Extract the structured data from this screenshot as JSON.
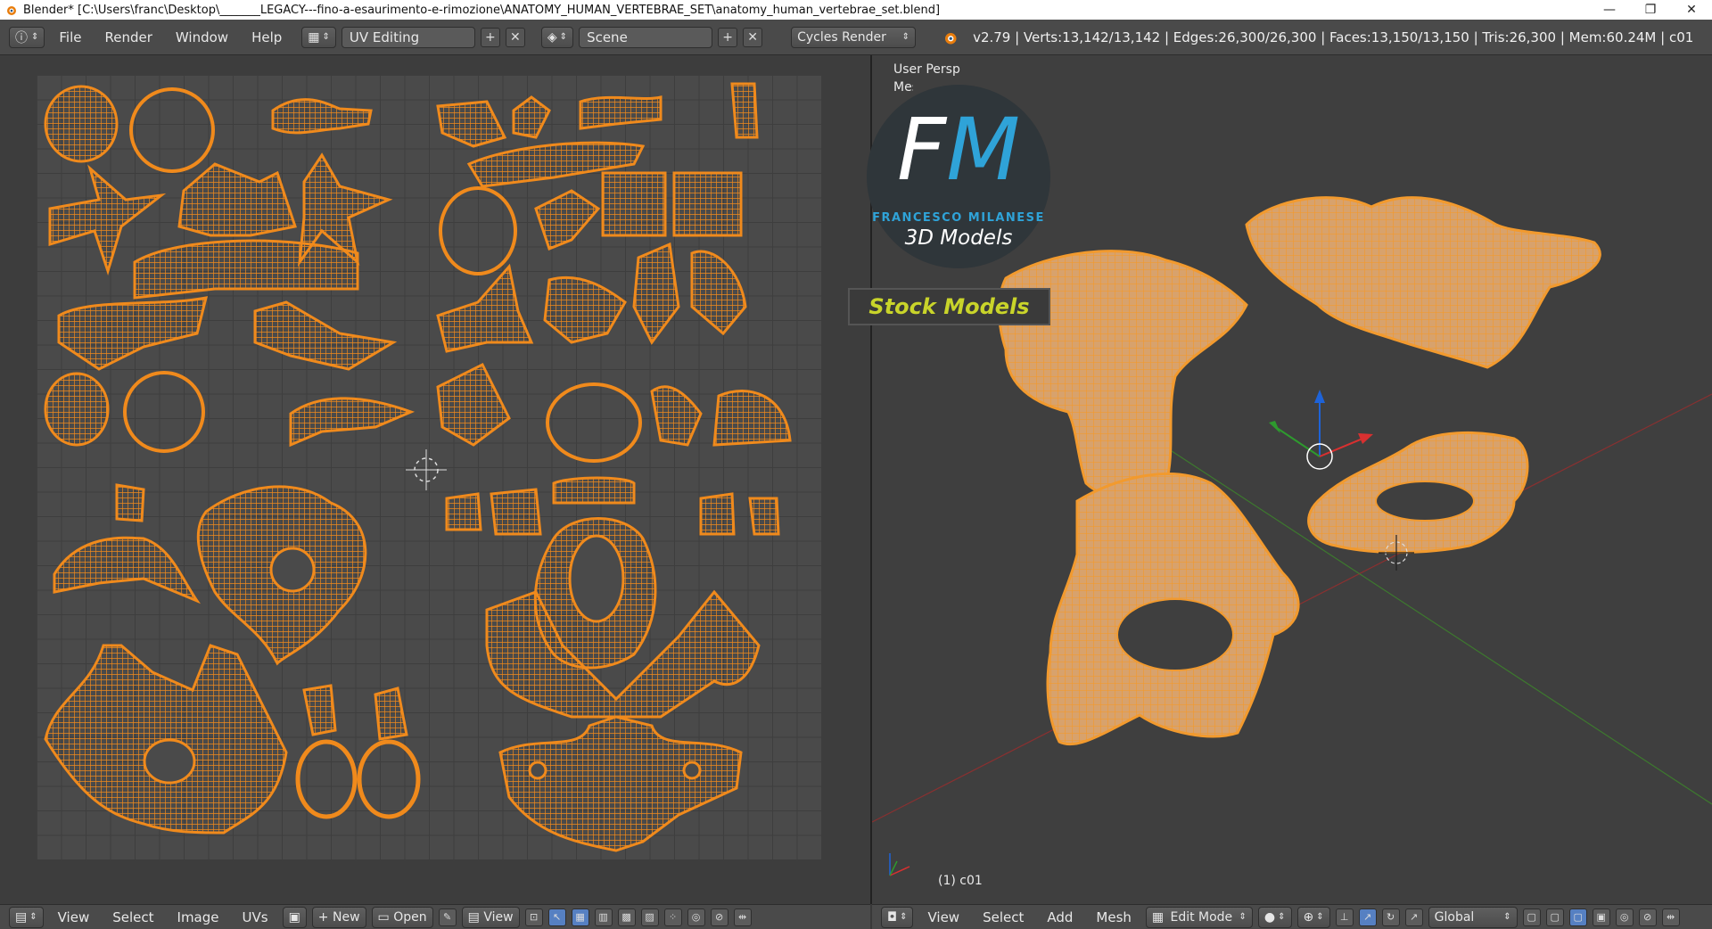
{
  "window": {
    "title": "Blender* [C:\\Users\\franc\\Desktop\\_______LEGACY---fino-a-esaurimento-e-rimozione\\ANATOMY_HUMAN_VERTEBRAE_SET\\anatomy_human_vertebrae_set.blend]",
    "minimize": "—",
    "restore": "❐",
    "close": "✕"
  },
  "info_header": {
    "menus": [
      "File",
      "Render",
      "Window",
      "Help"
    ],
    "screen_layout": "UV Editing",
    "scene": "Scene",
    "render_engine": "Cycles Render",
    "stats": "v2.79 | Verts:13,142/13,142 | Edges:26,300/26,300 | Faces:13,150/13,150 | Tris:26,300 | Mem:60.24M | c01"
  },
  "uv_editor": {
    "footer_menus": [
      "View",
      "Select",
      "Image",
      "UVs"
    ],
    "new_label": "New",
    "open_label": "Open",
    "view_label": "View"
  },
  "viewport": {
    "view_name": "User Persp",
    "partial_label": "Mesh",
    "object_label": "(1) c01",
    "footer_menus": [
      "View",
      "Select",
      "Add",
      "Mesh"
    ],
    "mode": "Edit Mode",
    "orientation": "Global"
  },
  "watermark": {
    "f": "F",
    "m": "M",
    "name": "FRANCESCO MILANESE",
    "subtitle": "3D Models",
    "badge": "Stock Models"
  },
  "colors": {
    "uv_orange": "#f08a1c",
    "mesh_orange": "#f29a2e",
    "logo_blue": "#2fa3d8",
    "badge_yellow": "#c9d42a"
  }
}
